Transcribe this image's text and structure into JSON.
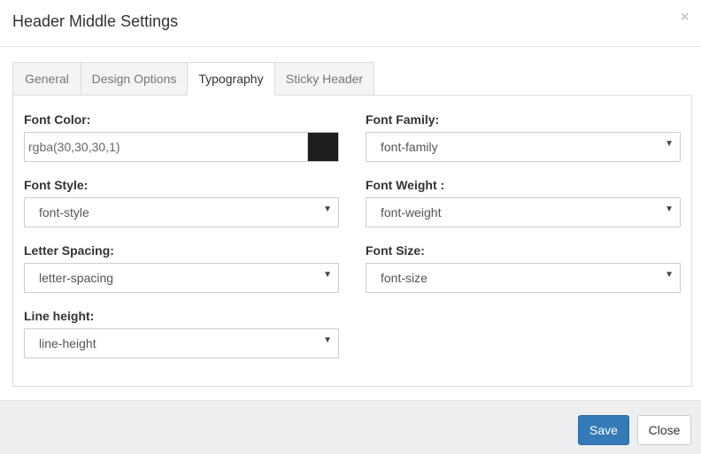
{
  "modal": {
    "title": "Header Middle Settings",
    "close_glyph": "×"
  },
  "tabs": [
    {
      "label": "General",
      "active": false
    },
    {
      "label": "Design Options",
      "active": false
    },
    {
      "label": "Typography",
      "active": true
    },
    {
      "label": "Sticky Header",
      "active": false
    }
  ],
  "fields": {
    "font_color": {
      "label": "Font Color:",
      "value": "rgba(30,30,30,1)",
      "swatch": "#1e1e1e"
    },
    "font_family": {
      "label": "Font Family:",
      "value": "font-family"
    },
    "font_style": {
      "label": "Font Style:",
      "value": "font-style"
    },
    "font_weight": {
      "label": "Font Weight :",
      "value": "font-weight"
    },
    "letter_spacing": {
      "label": "Letter Spacing:",
      "value": "letter-spacing"
    },
    "font_size": {
      "label": "Font Size:",
      "value": "font-size"
    },
    "line_height": {
      "label": "Line height:",
      "value": "line-height"
    }
  },
  "select_caret": "▼",
  "footer": {
    "save_label": "Save",
    "close_label": "Close"
  },
  "colors": {
    "primary": "#337ab7",
    "footer_bg": "#eceeef"
  }
}
